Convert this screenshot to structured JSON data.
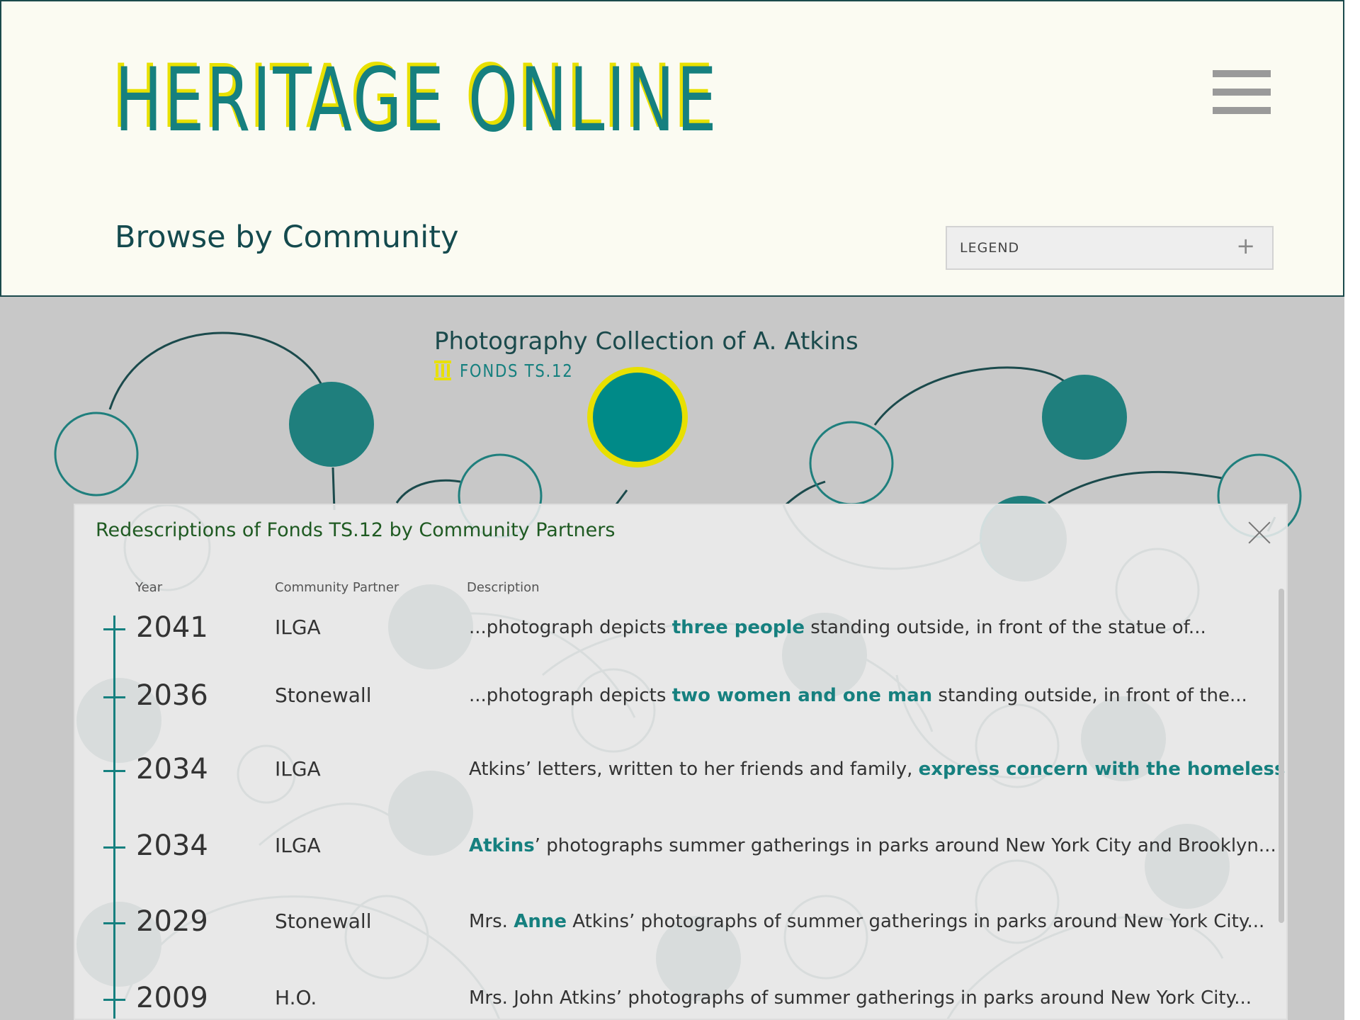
{
  "header": {
    "logo": "HERITAGE ONLINE",
    "page_title": "Browse by Community",
    "legend_label": "LEGEND",
    "legend_icon": "plus-icon",
    "menu_icon": "hamburger-menu-icon"
  },
  "collection": {
    "title": "Photography Collection of A. Atkins",
    "fonds_label": "FONDS TS.12",
    "fonds_icon": "archive-column-icon"
  },
  "panel": {
    "title": "Redescriptions of Fonds TS.12 by Community Partners",
    "close_icon": "close-icon",
    "headers": {
      "year": "Year",
      "partner": "Community Partner",
      "description": "Description"
    },
    "rows": [
      {
        "year": "2041",
        "partner": "ILGA",
        "pre": "...photograph depicts ",
        "hl": "three people",
        "post": " standing outside, in front of the statue of..."
      },
      {
        "year": "2036",
        "partner": "Stonewall",
        "pre": "...photograph depicts ",
        "hl": "two women and one man",
        "post": " standing outside, in front of the..."
      },
      {
        "year": "2034",
        "partner": "ILGA",
        "pre": "Atkins’ letters, written to her friends and family, ",
        "hl": "express concern with the homelessness",
        "post": "..."
      },
      {
        "year": "2034",
        "partner": "ILGA",
        "pre": "",
        "hl": "Atkins",
        "post": "’ photographs summer gatherings in parks around New York City and Brooklyn..."
      },
      {
        "year": "2029",
        "partner": "Stonewall",
        "pre": "Mrs. ",
        "hl": "Anne",
        "post": " Atkins’ photographs of summer gatherings in parks around New York City..."
      },
      {
        "year": "2009",
        "partner": "H.O.",
        "pre": "Mrs. John Atkins’ photographs of summer gatherings in parks around New York City...",
        "hl": "",
        "post": ""
      }
    ]
  },
  "colors": {
    "teal": "#16807f",
    "dark_teal": "#1f7f7d",
    "yellow": "#e8e000",
    "header_bg": "#fbfbf2",
    "graph_bg": "#c8c8c8"
  }
}
